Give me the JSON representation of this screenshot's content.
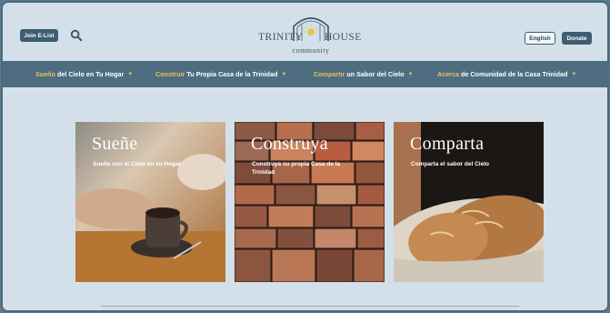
{
  "header": {
    "join_label": "Join E-List",
    "logo": {
      "word_left": "TRINITY",
      "word_right": "HOUSE",
      "sub": "community"
    },
    "english_label": "English",
    "donate_label": "Donate"
  },
  "nav": {
    "items": [
      {
        "highlight": "Sueño",
        "rest": "del Cielo en Tu Hogar"
      },
      {
        "highlight": "Construir",
        "rest": "Tu Propia Casa de la Trinidad"
      },
      {
        "highlight": "Compartir",
        "rest": "un Sabor del Cielo"
      },
      {
        "highlight": "Acerca",
        "rest": "de Comunidad de la Casa Trinidad"
      }
    ]
  },
  "cards": [
    {
      "title": "Sueñe",
      "subtitle": "Sueñe con el Cielo en su Hogar"
    },
    {
      "title": "Construya",
      "subtitle": "Construya su propia Casa de la Trinidad"
    },
    {
      "title": "Comparta",
      "subtitle": "Comparta el sabor del Cielo"
    }
  ],
  "colors": {
    "accent": "#e7c15c",
    "nav_bg": "#4e6d80",
    "page_bg": "#d4e0e9",
    "button_bg": "#3d5d70"
  }
}
